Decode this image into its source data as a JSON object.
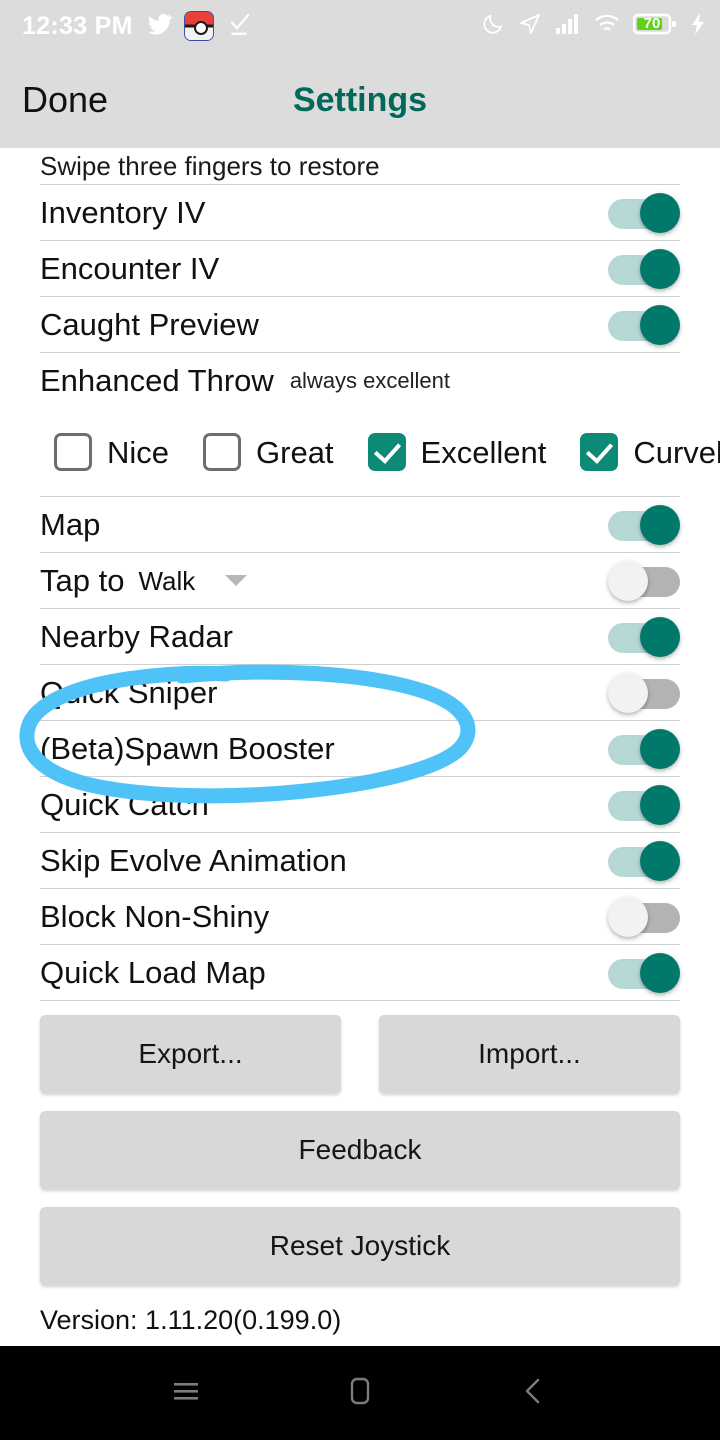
{
  "status_bar": {
    "time": "12:33 PM",
    "left_icons": [
      "twitter-icon",
      "pokeball-icon",
      "check-underline-icon"
    ],
    "right_icons": [
      "moon-icon",
      "location-arrow-icon",
      "signal-icon",
      "wifi-icon",
      "battery-icon",
      "charging-bolt-icon"
    ],
    "battery_level": "70"
  },
  "header": {
    "done_label": "Done",
    "title": "Settings",
    "title_color": "#00695c"
  },
  "hint": "Swipe three fingers to restore",
  "rows": [
    {
      "label": "Inventory IV",
      "toggle": "on"
    },
    {
      "label": "Encounter IV",
      "toggle": "on"
    },
    {
      "label": "Caught Preview",
      "toggle": "on"
    }
  ],
  "enhanced_throw": {
    "label": "Enhanced Throw",
    "subtitle": "always excellent",
    "options": [
      {
        "label": "Nice",
        "checked": false
      },
      {
        "label": "Great",
        "checked": false
      },
      {
        "label": "Excellent",
        "checked": true
      },
      {
        "label": "Curveball",
        "checked": true
      }
    ]
  },
  "rows2": [
    {
      "label": "Map",
      "toggle": "on"
    }
  ],
  "tap_to": {
    "prefix": "Tap to",
    "value": "Walk",
    "toggle": "off"
  },
  "rows3": [
    {
      "label": "Nearby Radar",
      "toggle": "on"
    },
    {
      "label": "Quick Sniper",
      "toggle": "off"
    },
    {
      "label": "(Beta)Spawn Booster",
      "toggle": "on"
    },
    {
      "label": "Quick Catch",
      "toggle": "on"
    },
    {
      "label": "Skip Evolve Animation",
      "toggle": "on"
    },
    {
      "label": "Block Non-Shiny",
      "toggle": "off"
    },
    {
      "label": "Quick Load Map",
      "toggle": "on"
    }
  ],
  "buttons": {
    "export": "Export...",
    "import": "Import...",
    "feedback": "Feedback",
    "reset_joystick": "Reset Joystick"
  },
  "version": "Version: 1.11.20(0.199.0)",
  "annotation": {
    "target": "(Beta)Spawn Booster",
    "color": "#4FC3F7",
    "shape": "hand-drawn-ellipse"
  },
  "android_nav": [
    "recents-icon",
    "home-icon",
    "back-icon"
  ],
  "colors": {
    "toggle_on_thumb": "#00796b",
    "toggle_on_track": "#b6d8d4",
    "toggle_off_track": "#b3b3b3",
    "checkbox_checked": "#0c8a76",
    "header_bg": "#dcdcdc",
    "button_bg": "#d8d8d8"
  }
}
